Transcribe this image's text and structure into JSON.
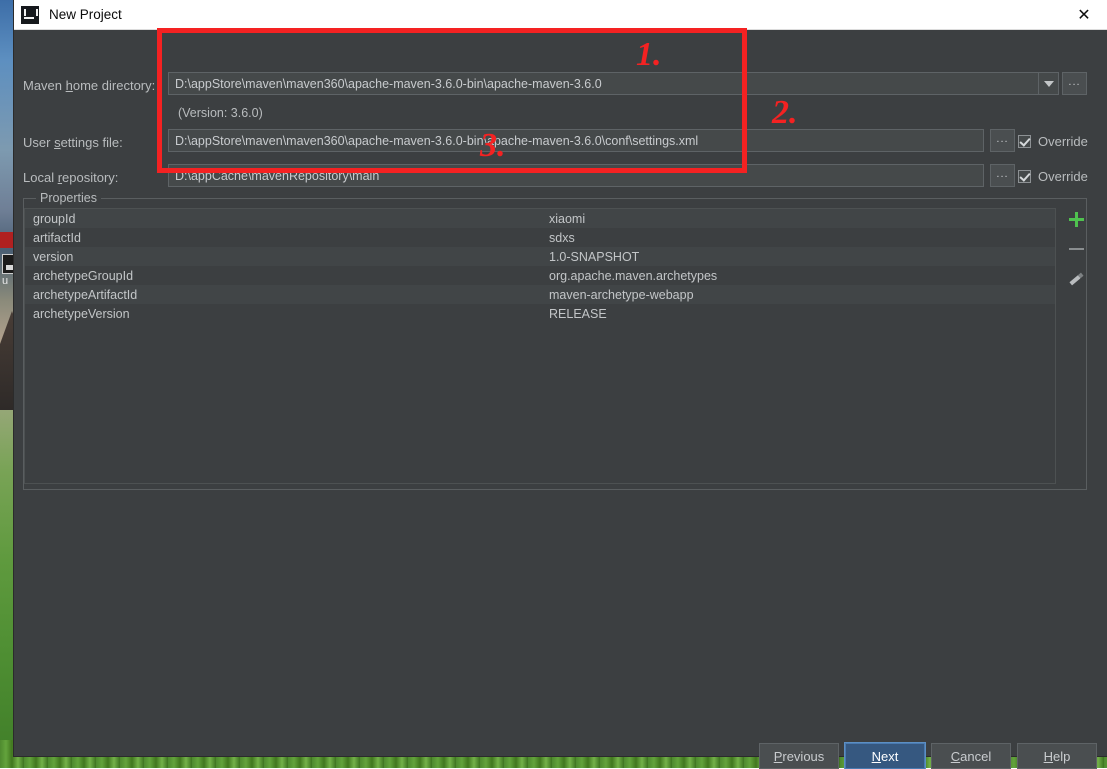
{
  "window": {
    "title": "New Project",
    "app_icon": "intellij-idea-icon",
    "close_label": "✕"
  },
  "form": {
    "maven_home": {
      "label_pre": "Maven ",
      "label_mnemonic": "h",
      "label_post": "ome directory:",
      "value": "D:\\appStore\\maven\\maven360\\apache-maven-3.6.0-bin\\apache-maven-3.6.0",
      "version_note": "(Version: 3.6.0)",
      "browse_label": "...",
      "dropdown_icon": "chevron-down-icon"
    },
    "user_settings": {
      "label_pre": "User ",
      "label_mnemonic": "s",
      "label_post": "ettings file:",
      "value": "D:\\appStore\\maven\\maven360\\apache-maven-3.6.0-bin\\apache-maven-3.6.0\\conf\\settings.xml",
      "browse_label": "...",
      "override_label": "Override",
      "override_checked": true
    },
    "local_repository": {
      "label_pre": "Local ",
      "label_mnemonic": "r",
      "label_post": "epository:",
      "value": "D:\\appCache\\mavenRepository\\main",
      "browse_label": "...",
      "override_label": "Override",
      "override_checked": true
    }
  },
  "properties": {
    "legend": "Properties",
    "rows": [
      {
        "name": "groupId",
        "value": "xiaomi"
      },
      {
        "name": "artifactId",
        "value": "sdxs"
      },
      {
        "name": "version",
        "value": "1.0-SNAPSHOT"
      },
      {
        "name": "archetypeGroupId",
        "value": "org.apache.maven.archetypes"
      },
      {
        "name": "archetypeArtifactId",
        "value": "maven-archetype-webapp"
      },
      {
        "name": "archetypeVersion",
        "value": "RELEASE"
      }
    ],
    "toolbar": {
      "add_icon": "plus-icon",
      "remove_icon": "minus-icon",
      "edit_icon": "pencil-icon"
    }
  },
  "footer": {
    "previous": {
      "pre": "",
      "mnemonic": "P",
      "post": "revious"
    },
    "next": {
      "pre": "",
      "mnemonic": "N",
      "post": "ext"
    },
    "cancel": {
      "pre": "",
      "mnemonic": "C",
      "post": "ancel"
    },
    "help": {
      "pre": "",
      "mnemonic": "H",
      "post": "elp"
    }
  },
  "annotations": {
    "mark1": "1.",
    "mark2": "2.",
    "mark3": "3.",
    "color": "#f42222"
  }
}
